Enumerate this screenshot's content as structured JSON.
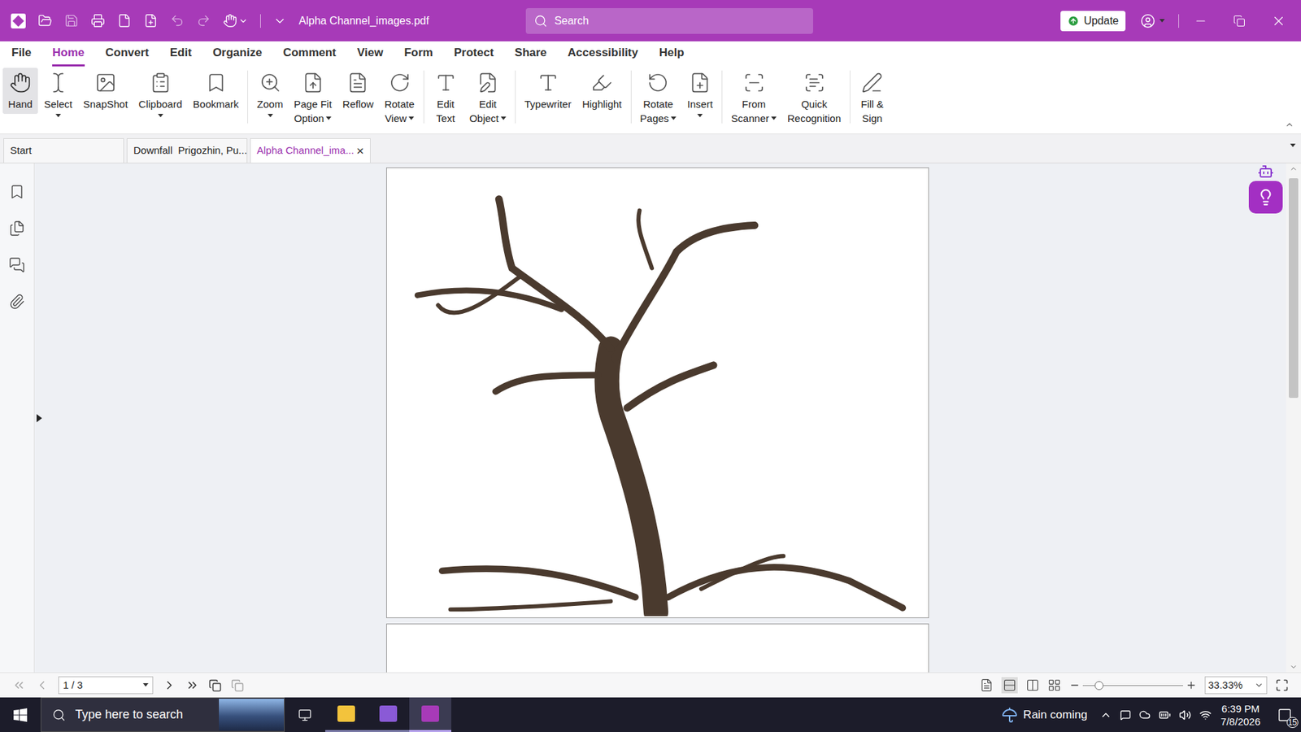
{
  "window": {
    "title": "Alpha Channel_images.pdf",
    "search_placeholder": "Search",
    "update_button": "Update"
  },
  "menu": [
    {
      "label": "File",
      "selected": false
    },
    {
      "label": "Home",
      "selected": true
    },
    {
      "label": "Convert",
      "selected": false
    },
    {
      "label": "Edit",
      "selected": false
    },
    {
      "label": "Organize",
      "selected": false
    },
    {
      "label": "Comment",
      "selected": false
    },
    {
      "label": "View",
      "selected": false
    },
    {
      "label": "Form",
      "selected": false
    },
    {
      "label": "Protect",
      "selected": false
    },
    {
      "label": "Share",
      "selected": false
    },
    {
      "label": "Accessibility",
      "selected": false
    },
    {
      "label": "Help",
      "selected": false
    }
  ],
  "ribbon": [
    [
      {
        "label": [
          "Hand"
        ],
        "dropdown": false,
        "selected": true
      },
      {
        "label": [
          "Select"
        ],
        "dropdown": true,
        "selected": false
      },
      {
        "label": [
          "SnapShot"
        ],
        "dropdown": false,
        "selected": false
      },
      {
        "label": [
          "Clipboard"
        ],
        "dropdown": true,
        "selected": false
      },
      {
        "label": [
          "Bookmark"
        ],
        "dropdown": false,
        "selected": false
      }
    ],
    [
      {
        "label": [
          "Zoom"
        ],
        "dropdown": true,
        "selected": false
      },
      {
        "label": [
          "Page Fit",
          "Option"
        ],
        "dropdown": true,
        "selected": false
      },
      {
        "label": [
          "Reflow"
        ],
        "dropdown": false,
        "selected": false
      },
      {
        "label": [
          "Rotate",
          "View"
        ],
        "dropdown": true,
        "selected": false
      }
    ],
    [
      {
        "label": [
          "Edit",
          "Text"
        ],
        "dropdown": false,
        "selected": false
      },
      {
        "label": [
          "Edit",
          "Object"
        ],
        "dropdown": true,
        "selected": false
      }
    ],
    [
      {
        "label": [
          "Typewriter"
        ],
        "dropdown": false,
        "selected": false
      },
      {
        "label": [
          "Highlight"
        ],
        "dropdown": false,
        "selected": false
      }
    ],
    [
      {
        "label": [
          "Rotate",
          "Pages"
        ],
        "dropdown": true,
        "selected": false
      },
      {
        "label": [
          "Insert"
        ],
        "dropdown": true,
        "selected": false
      }
    ],
    [
      {
        "label": [
          "From",
          "Scanner"
        ],
        "dropdown": true,
        "selected": false
      },
      {
        "label": [
          "Quick",
          "Recognition"
        ],
        "dropdown": false,
        "selected": false
      }
    ],
    [
      {
        "label": [
          "Fill &",
          "Sign"
        ],
        "dropdown": false,
        "selected": false
      }
    ]
  ],
  "doc_tabs": [
    {
      "label": "Start",
      "selected": false,
      "close": ""
    },
    {
      "label": "Downfall  Prigozhin, Pu...",
      "selected": false,
      "close": ""
    },
    {
      "label": "Alpha Channel_ima...",
      "selected": true,
      "close": "×"
    }
  ],
  "status_bar": {
    "page": "1 / 3",
    "zoom": "33.33%",
    "zoom_level": 0.16
  },
  "taskbar": {
    "search_placeholder": "Type here to search",
    "weather": "Rain coming",
    "time": "6:39 PM",
    "date": "7/8/2026",
    "notifications": "15",
    "apps": [
      {
        "selected": false
      },
      {
        "selected": false
      },
      {
        "selected": true
      }
    ]
  }
}
